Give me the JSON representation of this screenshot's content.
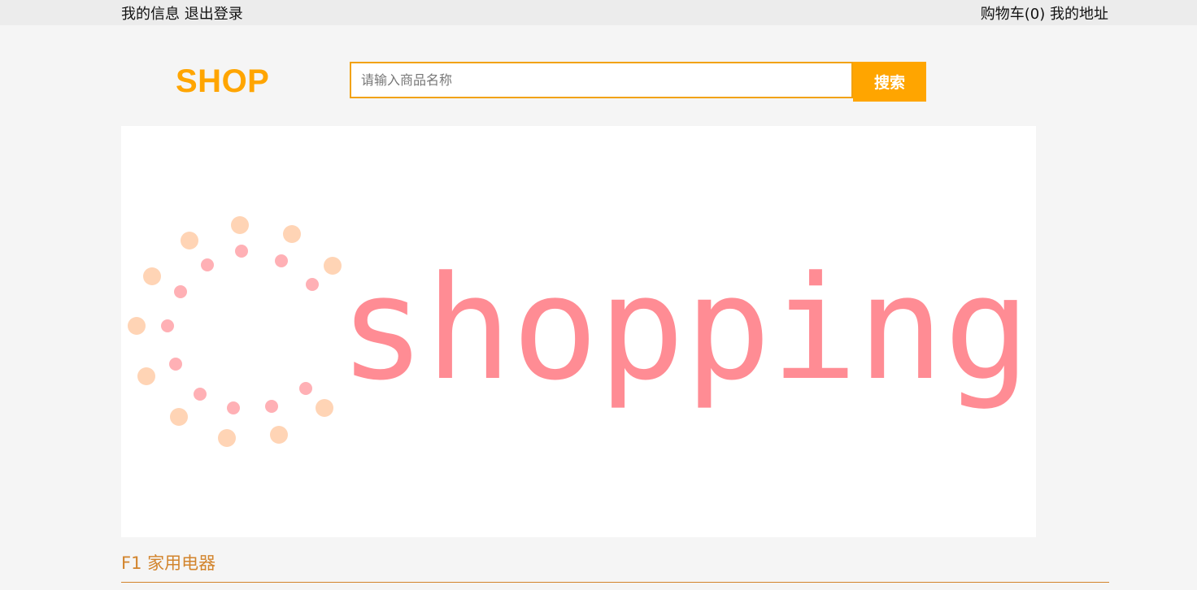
{
  "topbar": {
    "my_info": "我的信息",
    "logout": "退出登录",
    "cart": "购物车(0)",
    "my_address": "我的地址"
  },
  "header": {
    "logo": "SHOP",
    "search_placeholder": "请输入商品名称",
    "search_button": "搜索"
  },
  "banner": {
    "word": "shopping",
    "text_color": "#ff8c94",
    "dot_colors": [
      "#ffd4b5",
      "#ffb0b5"
    ]
  },
  "floor": {
    "title": "F1 家用电器"
  },
  "colors": {
    "accent": "#ffa500",
    "floor": "#d2842c"
  }
}
